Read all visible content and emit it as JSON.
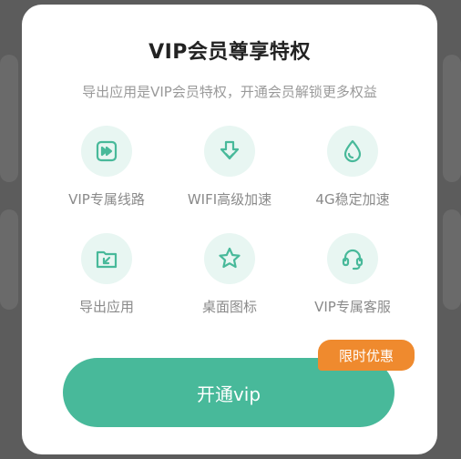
{
  "dialog": {
    "title": "VIP会员尊享特权",
    "subtitle": "导出应用是VIP会员特权，开通会员解锁更多权益",
    "accent_color": "#48b99a",
    "icon_bg_color": "#e8f6f2",
    "badge_color": "#ef8a2e"
  },
  "features": [
    {
      "label": "VIP专属线路",
      "icon": "fast-forward-icon"
    },
    {
      "label": "WIFI高级加速",
      "icon": "download-arrow-icon"
    },
    {
      "label": "4G稳定加速",
      "icon": "water-drop-icon"
    },
    {
      "label": "导出应用",
      "icon": "folder-export-icon"
    },
    {
      "label": "桌面图标",
      "icon": "star-icon"
    },
    {
      "label": "VIP专属客服",
      "icon": "headset-icon"
    }
  ],
  "cta": {
    "button_label": "开通vip",
    "badge_label": "限时优惠"
  }
}
